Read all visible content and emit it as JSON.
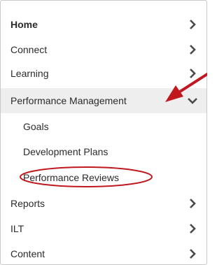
{
  "menu": {
    "items": [
      {
        "label": "Home",
        "icon": "chevron-right-icon"
      },
      {
        "label": "Connect",
        "icon": "chevron-right-icon"
      },
      {
        "label": "Learning",
        "icon": "chevron-right-icon"
      },
      {
        "label": "Performance Management",
        "icon": "chevron-down-icon",
        "expanded": true
      },
      {
        "label": "Goals"
      },
      {
        "label": "Development Plans"
      },
      {
        "label": "Performance Reviews"
      },
      {
        "label": "Reports",
        "icon": "chevron-right-icon"
      },
      {
        "label": "ILT",
        "icon": "chevron-right-icon"
      },
      {
        "label": "Content",
        "icon": "chevron-right-icon"
      }
    ]
  },
  "colors": {
    "annotation": "#c0181f",
    "active_row": "#eeeeee",
    "chevron": "#4a4a4a"
  }
}
